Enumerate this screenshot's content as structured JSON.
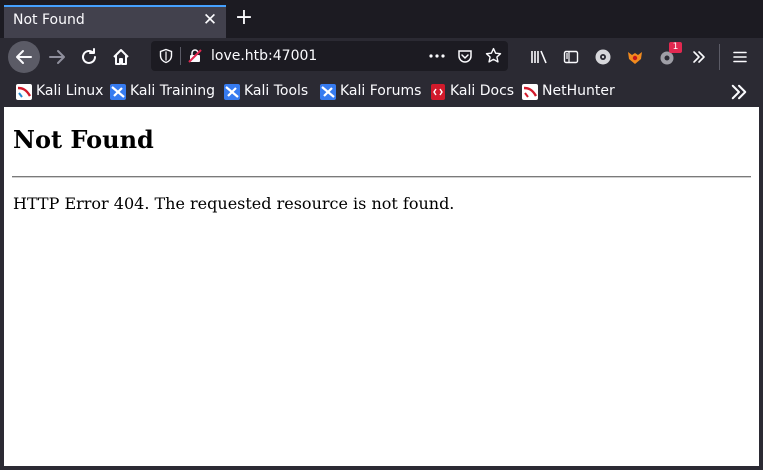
{
  "tab": {
    "title": "Not Found",
    "close_glyph": "✕",
    "new_tab_glyph": "+"
  },
  "urlbar": {
    "url": "love.htb:47001"
  },
  "extensions": {
    "badge_count": "1"
  },
  "bookmarks": [
    {
      "label": "Kali Linux",
      "icon": "kali-linux-icon"
    },
    {
      "label": "Kali Training",
      "icon": "kali-training-icon"
    },
    {
      "label": "Kali Tools",
      "icon": "kali-tools-icon"
    },
    {
      "label": "Kali Forums",
      "icon": "kali-forums-icon"
    },
    {
      "label": "Kali Docs",
      "icon": "kali-docs-icon"
    },
    {
      "label": "NetHunter",
      "icon": "nethunter-icon"
    }
  ],
  "page": {
    "heading": "Not Found",
    "message": "HTTP Error 404. The requested resource is not found."
  },
  "colors": {
    "accent": "#45a1ff",
    "tab_active": "#42414d",
    "toolbar": "#2b2a33",
    "tabstrip": "#1c1b22",
    "badge": "#e22850"
  }
}
